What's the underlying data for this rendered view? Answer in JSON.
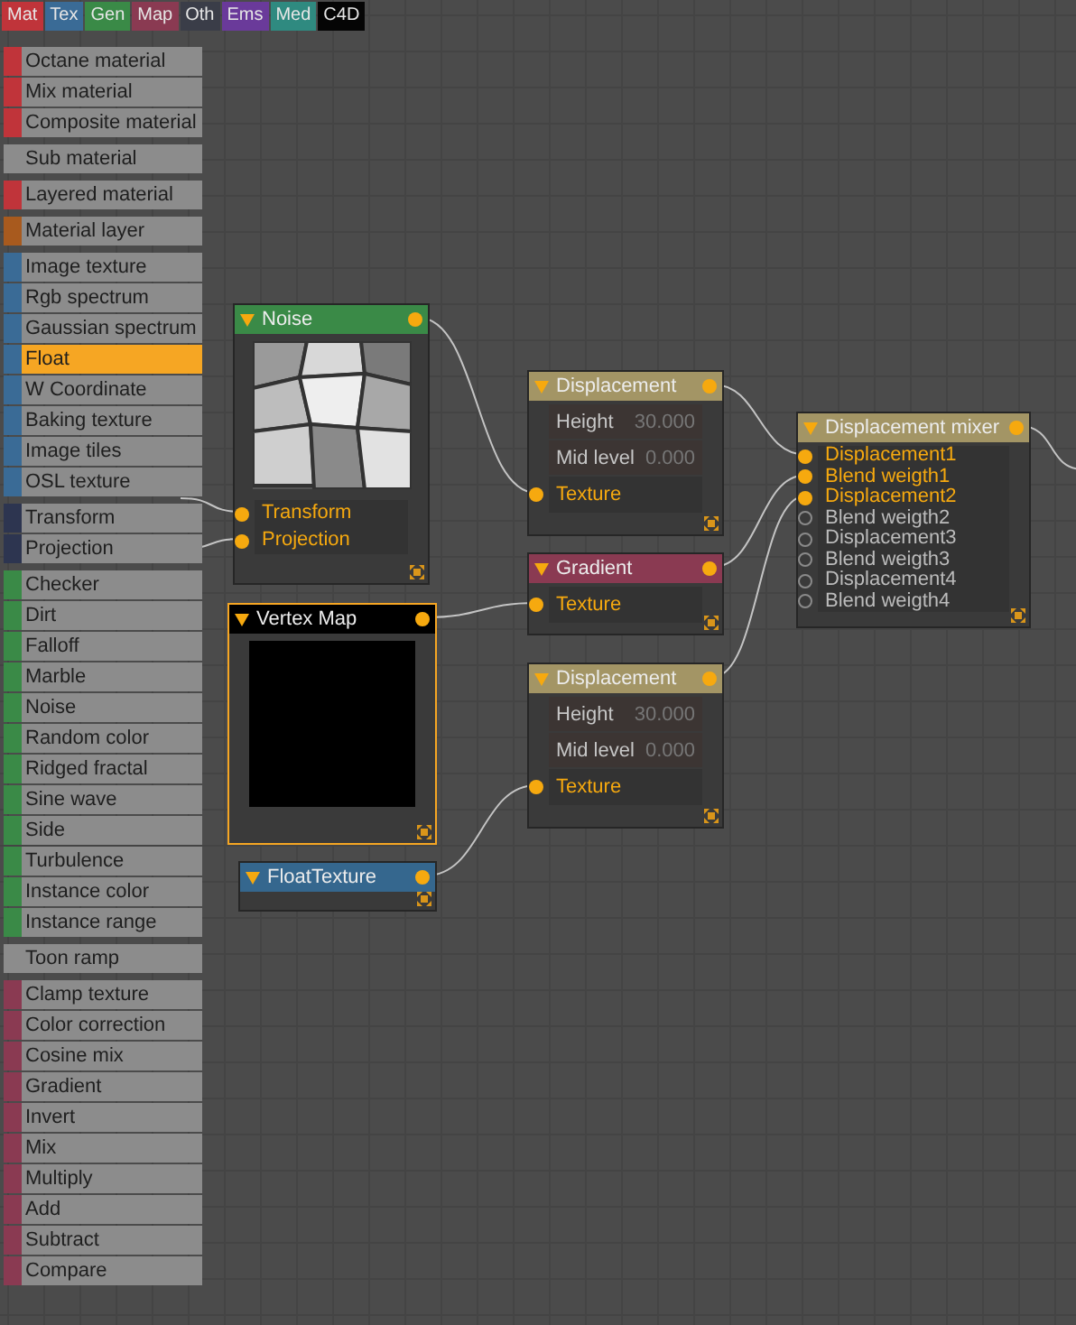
{
  "sidebar": {
    "tabs": [
      {
        "label": "Mat",
        "color": "#c0343a"
      },
      {
        "label": "Tex",
        "color": "#3a6b96"
      },
      {
        "label": "Gen",
        "color": "#3a8a47"
      },
      {
        "label": "Map",
        "color": "#8a3a52"
      },
      {
        "label": "Oth",
        "color": "#3a3d48"
      },
      {
        "label": "Ems",
        "color": "#6a3a9a"
      },
      {
        "label": "Med",
        "color": "#2f8a80"
      },
      {
        "label": "C4D",
        "color": "#050505"
      }
    ],
    "groups": [
      {
        "color": "#c0343a",
        "items": [
          {
            "label": "Octane material",
            "selected": false
          },
          {
            "label": "Mix material",
            "selected": false
          },
          {
            "label": "Composite material",
            "selected": false
          }
        ]
      },
      {
        "color": "#8c8c8c",
        "items": [
          {
            "label": "Sub material",
            "selected": false
          }
        ]
      },
      {
        "color": "#c0343a",
        "items": [
          {
            "label": "Layered material",
            "selected": false
          }
        ]
      },
      {
        "color": "#a85a1e",
        "items": [
          {
            "label": "Material layer",
            "selected": false
          }
        ]
      },
      {
        "color": "#3a6b96",
        "items": [
          {
            "label": "Image texture",
            "selected": false
          },
          {
            "label": "Rgb spectrum",
            "selected": false
          },
          {
            "label": "Gaussian spectrum",
            "selected": false
          },
          {
            "label": "Float",
            "selected": true
          },
          {
            "label": "W Coordinate",
            "selected": false
          },
          {
            "label": "Baking texture",
            "selected": false
          },
          {
            "label": "Image tiles",
            "selected": false
          },
          {
            "label": "OSL texture",
            "selected": false
          }
        ]
      },
      {
        "color": "#2d3550",
        "items": [
          {
            "label": "Transform",
            "selected": false
          },
          {
            "label": "Projection",
            "selected": false
          }
        ]
      },
      {
        "color": "#3a8a47",
        "items": [
          {
            "label": "Checker",
            "selected": false
          },
          {
            "label": "Dirt",
            "selected": false
          },
          {
            "label": "Falloff",
            "selected": false
          },
          {
            "label": "Marble",
            "selected": false
          },
          {
            "label": "Noise",
            "selected": false
          },
          {
            "label": "Random color",
            "selected": false
          },
          {
            "label": "Ridged fractal",
            "selected": false
          },
          {
            "label": "Sine wave",
            "selected": false
          },
          {
            "label": "Side",
            "selected": false
          },
          {
            "label": "Turbulence",
            "selected": false
          },
          {
            "label": "Instance color",
            "selected": false
          },
          {
            "label": "Instance range",
            "selected": false
          }
        ]
      },
      {
        "color": "#8c8c8c",
        "items": [
          {
            "label": "Toon ramp",
            "selected": false
          }
        ]
      },
      {
        "color": "#8a3a52",
        "items": [
          {
            "label": "Clamp texture",
            "selected": false
          },
          {
            "label": "Color correction",
            "selected": false
          },
          {
            "label": "Cosine mix",
            "selected": false
          },
          {
            "label": "Gradient",
            "selected": false
          },
          {
            "label": "Invert",
            "selected": false
          },
          {
            "label": "Mix",
            "selected": false
          },
          {
            "label": "Multiply",
            "selected": false
          },
          {
            "label": "Add",
            "selected": false
          },
          {
            "label": "Subtract",
            "selected": false
          },
          {
            "label": "Compare",
            "selected": false
          }
        ]
      }
    ]
  },
  "nodes": [
    {
      "title": "Noise",
      "kind": "picture",
      "color": "#3a8a47",
      "selected": false,
      "inputs": [
        {
          "label": "Transform",
          "connected": true
        },
        {
          "label": "Projection",
          "connected": true
        }
      ]
    },
    {
      "title": "Displacement",
      "kind": "basic",
      "color": "#a39565",
      "selected": false,
      "params": [
        {
          "label": "Height",
          "value": "30.000"
        },
        {
          "label": "Mid level",
          "value": "0.000"
        }
      ],
      "inputs": [
        {
          "label": "Texture",
          "connected": true
        }
      ]
    },
    {
      "title": "Gradient",
      "kind": "basic",
      "color": "#8a3a52",
      "selected": false,
      "inputs": [
        {
          "label": "Texture",
          "connected": true
        }
      ]
    },
    {
      "title": "Displacement",
      "kind": "basic",
      "color": "#a39565",
      "selected": false,
      "params": [
        {
          "label": "Height",
          "value": "30.000"
        },
        {
          "label": "Mid level",
          "value": "0.000"
        }
      ],
      "inputs": [
        {
          "label": "Texture",
          "connected": true
        }
      ]
    },
    {
      "title": "Displacement mixer",
      "kind": "basic",
      "color": "#a39565",
      "selected": false,
      "inputs": [
        {
          "label": "Displacement1",
          "connected": true
        },
        {
          "label": "Blend weigth1",
          "connected": true
        },
        {
          "label": "Displacement2",
          "connected": true
        },
        {
          "label": "Blend weigth2",
          "connected": false
        },
        {
          "label": "Displacement3",
          "connected": false
        },
        {
          "label": "Blend weigth3",
          "connected": false
        },
        {
          "label": "Displacement4",
          "connected": false
        },
        {
          "label": "Blend weigth4",
          "connected": false
        }
      ]
    },
    {
      "title": "Vertex Map",
      "kind": "swatch",
      "color": "#000000",
      "selected": true
    },
    {
      "title": "FloatTexture",
      "kind": "basic",
      "color": "#35678e",
      "selected": false
    }
  ]
}
